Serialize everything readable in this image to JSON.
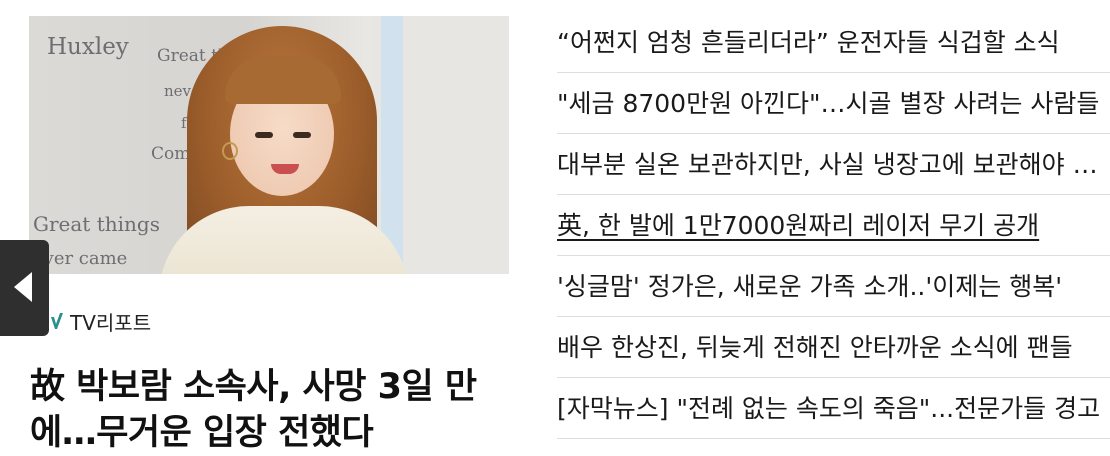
{
  "featured": {
    "photo_sign": {
      "brand": "Huxley",
      "line1": "Great thi",
      "line2": "never c",
      "line3": "fro",
      "line4": "Comf",
      "bottom1": "Great things",
      "bottom2": "ever came"
    },
    "source_name": "TV리포트",
    "headline": "故 박보람 소속사, 사망 3일 만에…무거운 입장 전했다"
  },
  "prev_icon": "left-arrow-icon",
  "related_articles": [
    {
      "title": "“어쩐지 엄청 흔들리더라” 운전자들 식겁할 소식"
    },
    {
      "title": "\"세금 8700만원 아낀다\"…시골 별장 사려는 사람들"
    },
    {
      "title": "대부분 실온 보관하지만, 사실 냉장고에 보관해야 하는 것"
    },
    {
      "title": "英, 한 발에 1만7000원짜리 레이저 무기 공개"
    },
    {
      "title": "'싱글맘' 정가은, 새로운 가족 소개..'이제는 행복'"
    },
    {
      "title": "배우 한상진, 뒤늦게 전해진 안타까운 소식에 팬들"
    },
    {
      "title": "[자막뉴스] \"전례 없는 속도의 죽음\"...전문가들 경고"
    }
  ]
}
